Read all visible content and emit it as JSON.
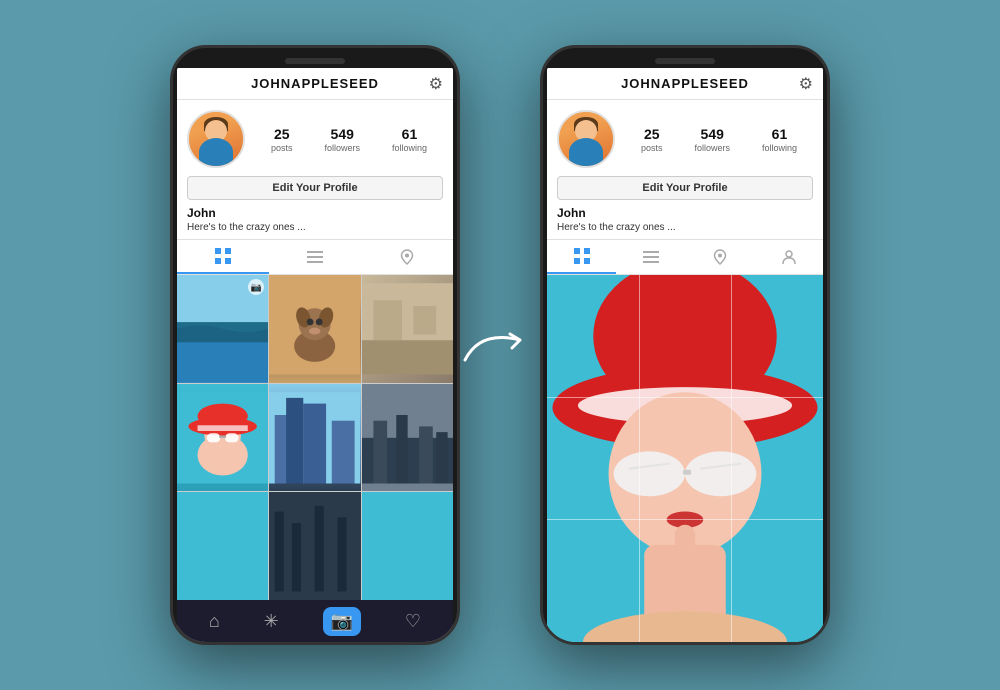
{
  "background_color": "#5a9aaa",
  "left_phone": {
    "header": {
      "title": "JOHNAPPLESEED",
      "gear_icon": "⚙"
    },
    "profile": {
      "stats": [
        {
          "number": "25",
          "label": "posts"
        },
        {
          "number": "549",
          "label": "followers"
        },
        {
          "number": "61",
          "label": "following"
        }
      ],
      "edit_button": "Edit Your Profile",
      "name": "John",
      "bio": "Here's to the crazy ones ..."
    },
    "tabs": [
      {
        "icon": "⊞",
        "active": true,
        "label": "grid"
      },
      {
        "icon": "≡",
        "active": false,
        "label": "list"
      },
      {
        "icon": "📍",
        "active": false,
        "label": "location"
      }
    ],
    "bottom_nav": [
      {
        "icon": "⌂",
        "label": "home"
      },
      {
        "icon": "✳",
        "label": "explore"
      },
      {
        "icon": "📷",
        "label": "camera",
        "active": true
      },
      {
        "icon": "♡",
        "label": "likes"
      }
    ]
  },
  "right_phone": {
    "header": {
      "title": "JOHNAPPLESEED",
      "gear_icon": "⚙"
    },
    "profile": {
      "stats": [
        {
          "number": "25",
          "label": "posts"
        },
        {
          "number": "549",
          "label": "followers"
        },
        {
          "number": "61",
          "label": "following"
        }
      ],
      "edit_button": "Edit Your Profile",
      "name": "John",
      "bio": "Here's to the crazy ones ..."
    },
    "tabs": [
      {
        "icon": "⊞",
        "active": true,
        "label": "grid"
      },
      {
        "icon": "≡",
        "active": false,
        "label": "list"
      },
      {
        "icon": "📍",
        "active": false,
        "label": "location"
      },
      {
        "icon": "👤",
        "active": false,
        "label": "tagged"
      }
    ],
    "bottom_nav": []
  },
  "arrow": "→"
}
